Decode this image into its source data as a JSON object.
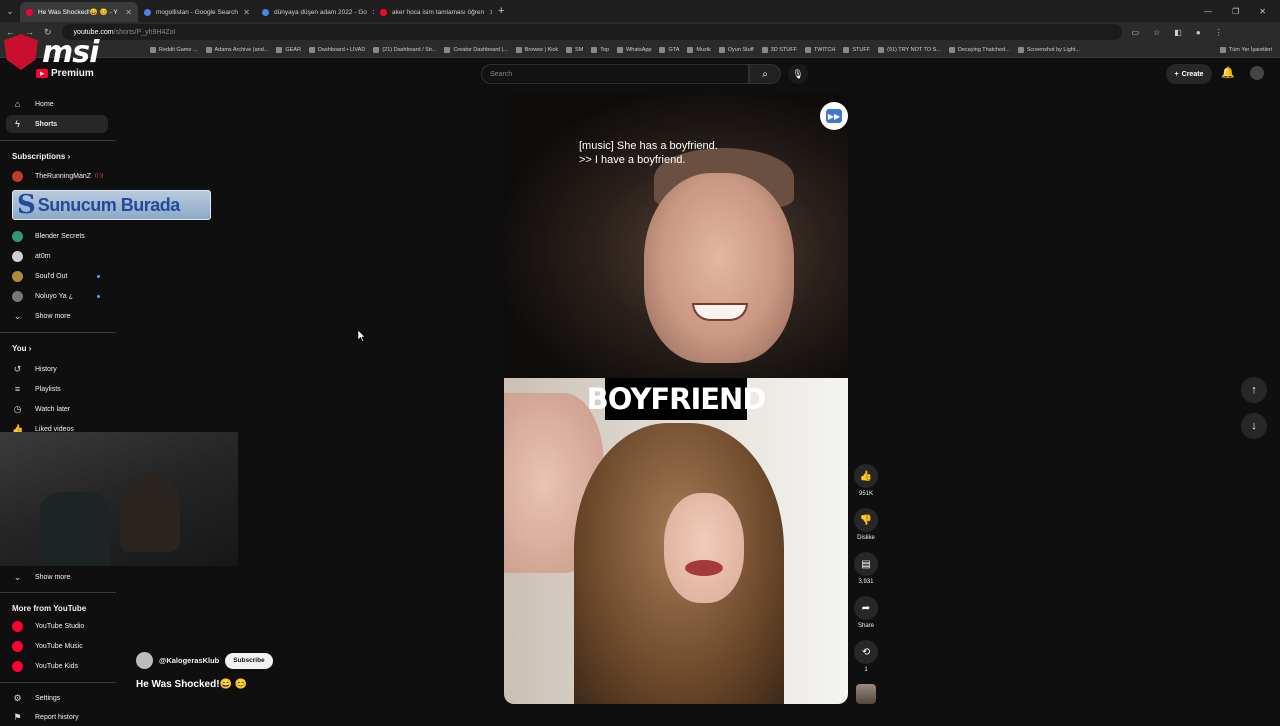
{
  "browser": {
    "tabs": [
      {
        "title": "He Was Shocked!😄 😊 - Y",
        "active": true,
        "fav": "#ff0033"
      },
      {
        "title": "mogollistan - Google Search",
        "active": false,
        "fav": "#4285f4"
      },
      {
        "title": "dünyaya düşen adam 2022 - Go",
        "active": false,
        "fav": "#4285f4"
      },
      {
        "title": "aker hoca isim tamlaması öğren",
        "active": false,
        "fav": "#ff0033"
      }
    ],
    "new_tab": "+",
    "url": "youtube.com",
    "url_path": "/shorts/P_yh9H4ZoI",
    "bookmarks": [
      "Reddit Game ...",
      "Adams Archive (and...",
      "GEAR",
      "Dashboard • LIVAD",
      "(21) Dashboard / Str...",
      "Creator Dashboard |...",
      "Browse | Kick",
      "SM",
      "Top",
      "WhatsApp",
      "GTA",
      "Muzik",
      "Oyun Stuff",
      "3D STUFF",
      "TWITCH",
      "STUFF",
      "(91) TRY NOT TO S...",
      "Decaying Thatched...",
      "Screenshot by Light..."
    ],
    "bookmarks_right": "Tüm Yer İşaretleri"
  },
  "overlay": {
    "msi": "msi",
    "banner_s": "S",
    "banner_text": "Sunucum Burada"
  },
  "header": {
    "premium": "Premium",
    "search_placeholder": "Search",
    "create": "Create"
  },
  "sidebar": {
    "home": "Home",
    "shorts": "Shorts",
    "subscriptions": "Subscriptions",
    "subs": [
      {
        "name": "TheRunningManZ",
        "live": "((·))",
        "color": "#c0392b"
      },
      {
        "name": "Blender Secrets",
        "color": "#2d9b6f"
      },
      {
        "name": "at0m",
        "color": "#d0d0d0"
      },
      {
        "name": "Soul'd Out",
        "color": "#b08a3a"
      },
      {
        "name": "Noluyo Ya ¿",
        "color": "#777"
      }
    ],
    "show_more_1": "Show more",
    "you": "You",
    "history": "History",
    "playlists": "Playlists",
    "watch_later": "Watch later",
    "liked_videos": "Liked videos",
    "show_more_2": "Show more",
    "more_from": "More from YouTube",
    "studio": "YouTube Studio",
    "music": "YouTube Music",
    "kids": "YouTube Kids",
    "settings": "Settings",
    "report_history": "Report history"
  },
  "short": {
    "caption_line1": "[music] She has a boyfriend.",
    "caption_line2": ">> I have a boyfriend.",
    "overlay_word": "BOYFRIEND",
    "likes": "951K",
    "dislike": "Dislike",
    "comments": "3,931",
    "share": "Share",
    "remix": "1",
    "channel": "@KalogerasKlub",
    "subscribe": "Subscribe",
    "title": "He Was Shocked!😄 😊"
  }
}
